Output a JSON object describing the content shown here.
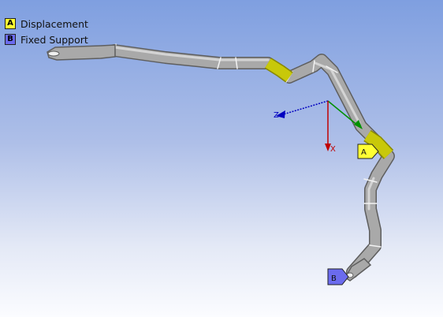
{
  "legend": {
    "items": [
      {
        "key": "A",
        "label": "Displacement",
        "color": "#ffff33"
      },
      {
        "key": "B",
        "label": "Fixed Support",
        "color": "#6b6bee"
      }
    ]
  },
  "markers": [
    {
      "key": "A",
      "color": "#ffff33"
    },
    {
      "key": "B",
      "color": "#6b6bee"
    }
  ],
  "triad": {
    "x_label": "X",
    "z_label": "Z",
    "x_color": "#c00000",
    "y_color": "#009000",
    "z_color": "#0000c0"
  },
  "colors": {
    "tube": "#a9a9a9",
    "tube_edge": "#5e5e5e",
    "highlight": "#c8c80a"
  }
}
